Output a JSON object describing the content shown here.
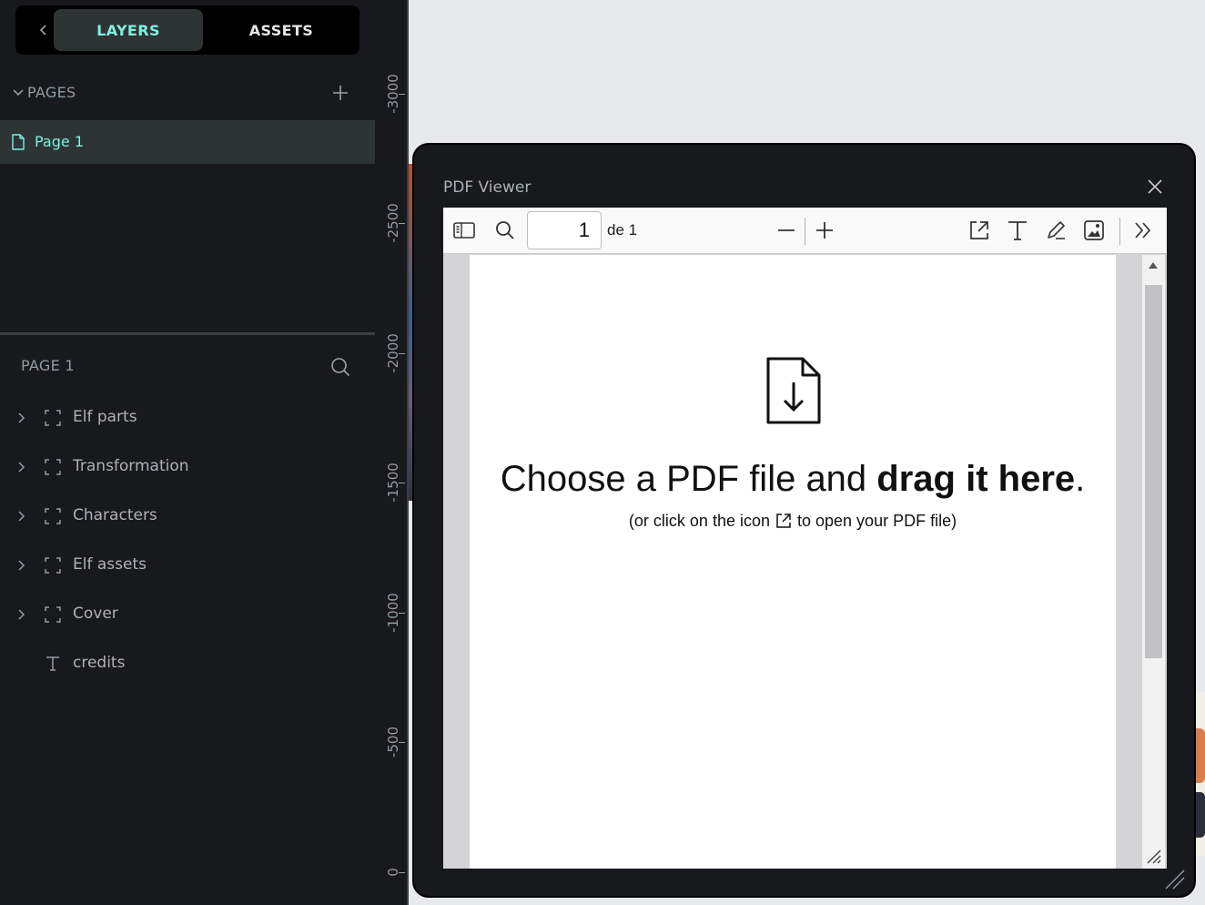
{
  "sidebar": {
    "tabs": {
      "layers": "LAYERS",
      "assets": "ASSETS"
    },
    "pages_section": {
      "title": "PAGES",
      "pages": [
        {
          "label": "Page 1"
        }
      ]
    },
    "layers_section": {
      "title": "PAGE 1",
      "items": [
        {
          "label": "Elf parts",
          "type": "board",
          "icon": "board-icon"
        },
        {
          "label": "Transformation",
          "type": "board",
          "icon": "board-icon"
        },
        {
          "label": "Characters",
          "type": "board",
          "icon": "board-icon"
        },
        {
          "label": "Elf assets",
          "type": "board",
          "icon": "board-icon"
        },
        {
          "label": "Cover",
          "type": "board",
          "icon": "board-icon"
        },
        {
          "label": "credits",
          "type": "text",
          "icon": "text-icon"
        }
      ]
    }
  },
  "ruler": {
    "ticks": [
      "-3000",
      "-2500",
      "-2000",
      "-1500",
      "-1000",
      "-500",
      "0"
    ]
  },
  "pdf_viewer": {
    "title": "PDF Viewer",
    "toolbar": {
      "page_value": "1",
      "page_count": "de 1"
    },
    "drop_zone": {
      "headline_regular": "Choose a PDF file and ",
      "headline_bold": "drag it here",
      "headline_end": ".",
      "sub_before": "(or click on the icon",
      "sub_after": "to open your PDF file)"
    }
  },
  "colors": {
    "accent": "#7ef0e0",
    "sidebar_bg": "#18191c",
    "selected_bg": "#2e3434",
    "canvas_bg": "#e8e9ec"
  }
}
